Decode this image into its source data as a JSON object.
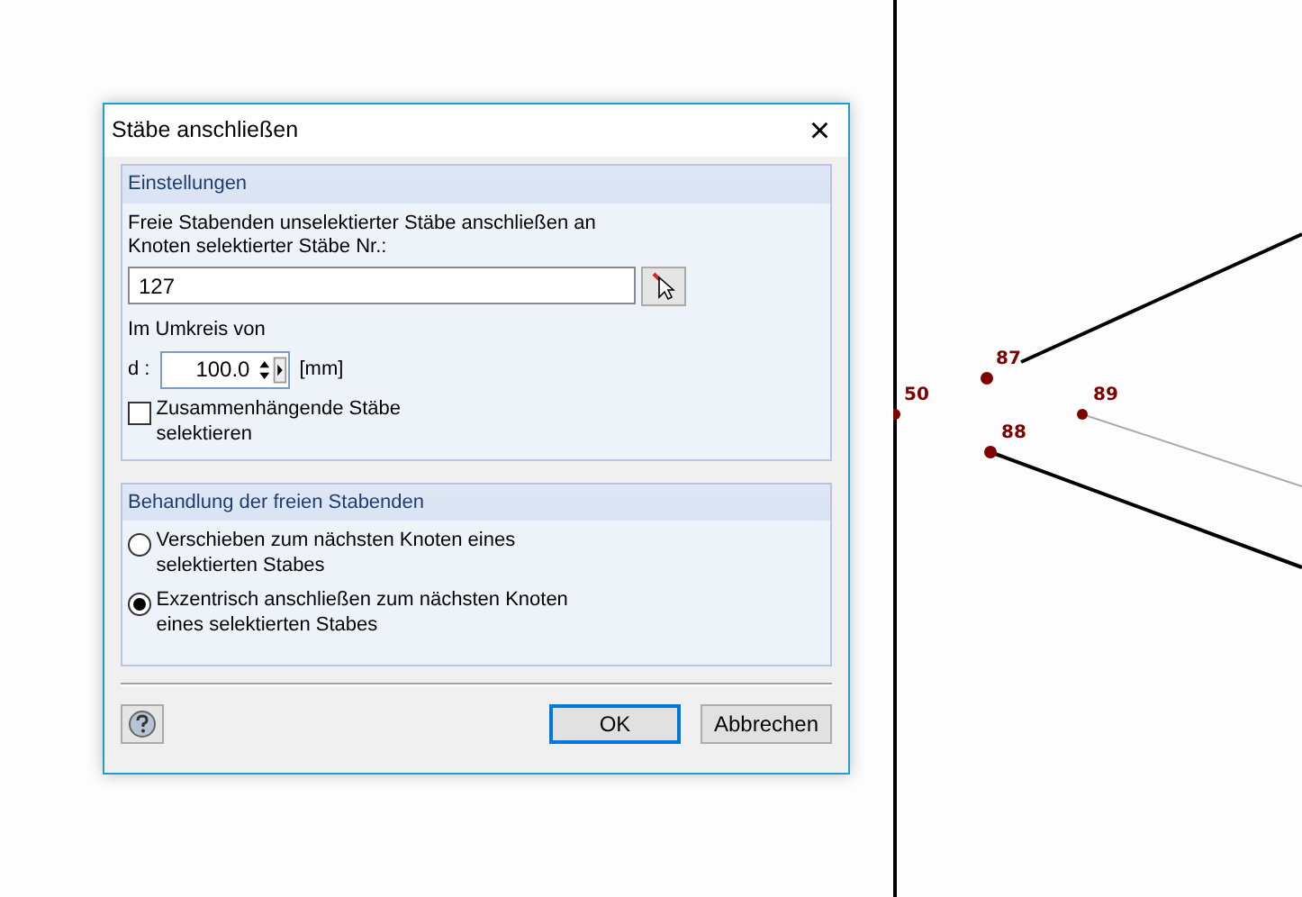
{
  "dialog": {
    "title": "Stäbe anschließen",
    "close": "×"
  },
  "settings": {
    "heading": "Einstellungen",
    "description": "Freie Stabenden unselektierter Stäbe anschließen an Knoten selektierter Stäbe Nr.:",
    "members_value": "127",
    "radius_label": "Im Umkreis von",
    "d_label": "d :",
    "d_value": "100.0",
    "unit": "[mm]",
    "select_connected": {
      "label": "Zusammenhängende Stäbe selektieren",
      "checked": false
    }
  },
  "treatment": {
    "heading": "Behandlung der freien Stabenden",
    "options": [
      {
        "label": "Verschieben zum nächsten Knoten eines selektierten Stabes",
        "selected": false
      },
      {
        "label": "Exzentrisch anschließen zum nächsten Knoten eines selektierten Stabes",
        "selected": true
      }
    ]
  },
  "buttons": [
    {
      "label": "OK",
      "default": true
    },
    {
      "label": "Abbrechen",
      "default": false
    }
  ],
  "canvas": {
    "nodes": [
      {
        "label": "50"
      },
      {
        "label": "87"
      },
      {
        "label": "88"
      },
      {
        "label": "89"
      }
    ]
  }
}
